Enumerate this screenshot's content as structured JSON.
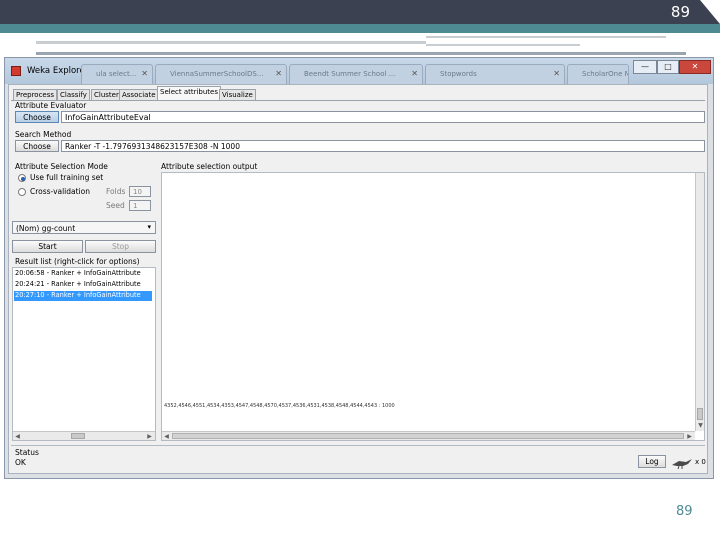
{
  "slide": {
    "page_number_top": "89",
    "page_number_bottom": "89"
  },
  "window": {
    "title": "Weka Explorer",
    "background_tabs": [
      "ula select...",
      "ViennaSummerSchoolDS...",
      "Beendt Summer School ...",
      "Stopwords",
      "ScholarOne M"
    ],
    "controls": [
      "—",
      "□",
      "✕"
    ]
  },
  "tabs": [
    "Preprocess",
    "Classify",
    "Cluster",
    "Associate",
    "Select attributes",
    "Visualize"
  ],
  "active_tab": "Select attributes",
  "attribute_evaluator": {
    "heading": "Attribute Evaluator",
    "choose_label": "Choose",
    "value": "InfoGainAttributeEval"
  },
  "search_method": {
    "heading": "Search Method",
    "choose_label": "Choose",
    "value": "Ranker -T -1.7976931348623157E308 -N 1000"
  },
  "selection_mode": {
    "heading": "Attribute Selection Mode",
    "use_full_training": "Use full training set",
    "cross_validation": "Cross-validation",
    "folds_label": "Folds",
    "folds_value": "10",
    "seed_label": "Seed",
    "seed_value": "1"
  },
  "class_select": {
    "value": "(Nom) gg-count"
  },
  "buttons": {
    "start": "Start",
    "stop": "Stop",
    "log": "Log"
  },
  "result_list": {
    "heading": "Result list (right-click for options)",
    "items": [
      "20:06:58 - Ranker + InfoGainAttribute",
      "20:24:21 - Ranker + InfoGainAttribute",
      "20:27:10 - Ranker + InfoGainAttribute"
    ],
    "selected_index": 2
  },
  "output": {
    "heading": "Attribute selection output",
    "line": "4352,4546,4551,4534,4353,4547,4548,4570,4537,4536,4531,4538,4548,4544,4543 : 1000"
  },
  "status": {
    "heading": "Status",
    "text": "OK",
    "count": "x 0"
  },
  "colors": {
    "title_bar_top": "#3b4150",
    "accent_teal": "#4d8a92",
    "selection": "#3399ff",
    "close_button": "#c9473d"
  }
}
